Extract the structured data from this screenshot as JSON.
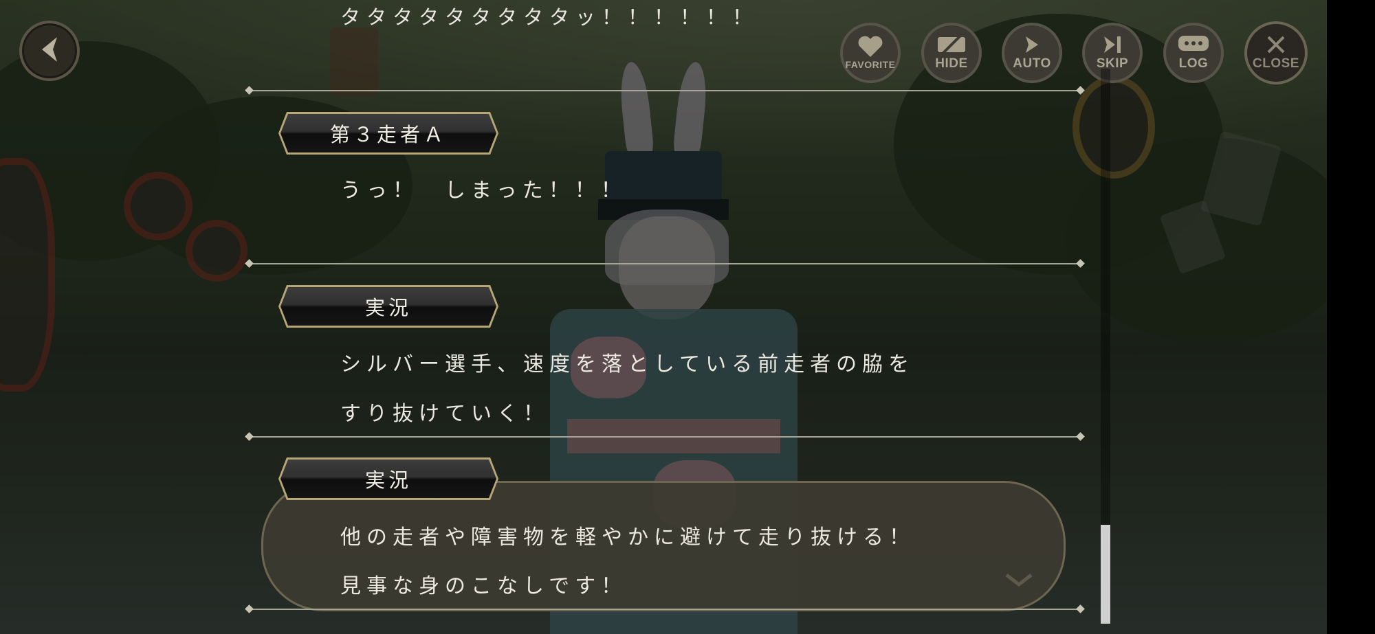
{
  "controls": {
    "favorite_label": "FAVORITE",
    "hide_label": "HIDE",
    "auto_label": "AUTO",
    "skip_label": "SKIP",
    "log_label": "LOG",
    "close_label": "CLOSE"
  },
  "log": {
    "first_line": "タタタタタタタタタッ！！！！！！",
    "entries": [
      {
        "speaker": "第３走者Ａ",
        "lines": [
          "うっ！　しまった！！！"
        ]
      },
      {
        "speaker": "実況",
        "lines": [
          "シルバー選手、速度を落としている前走者の脇を",
          "すり抜けていく！"
        ]
      },
      {
        "speaker": "実況",
        "lines": [
          "他の走者や障害物を軽やかに避けて走り抜ける！",
          "見事な身のこなしです！"
        ]
      }
    ]
  },
  "icons": {
    "back": "back-arrow-icon",
    "favorite": "heart-icon",
    "hide": "hide-icon",
    "auto": "play-arrow-icon",
    "skip": "skip-icon",
    "log": "chat-bubble-icon",
    "close": "close-x-icon",
    "next": "chevron-down-icon"
  },
  "colors": {
    "control_text": "#aaa593",
    "nameplate_border": "#b7a777",
    "text": "#ece9e0"
  },
  "scroll": {
    "position_fraction": 1.0
  }
}
